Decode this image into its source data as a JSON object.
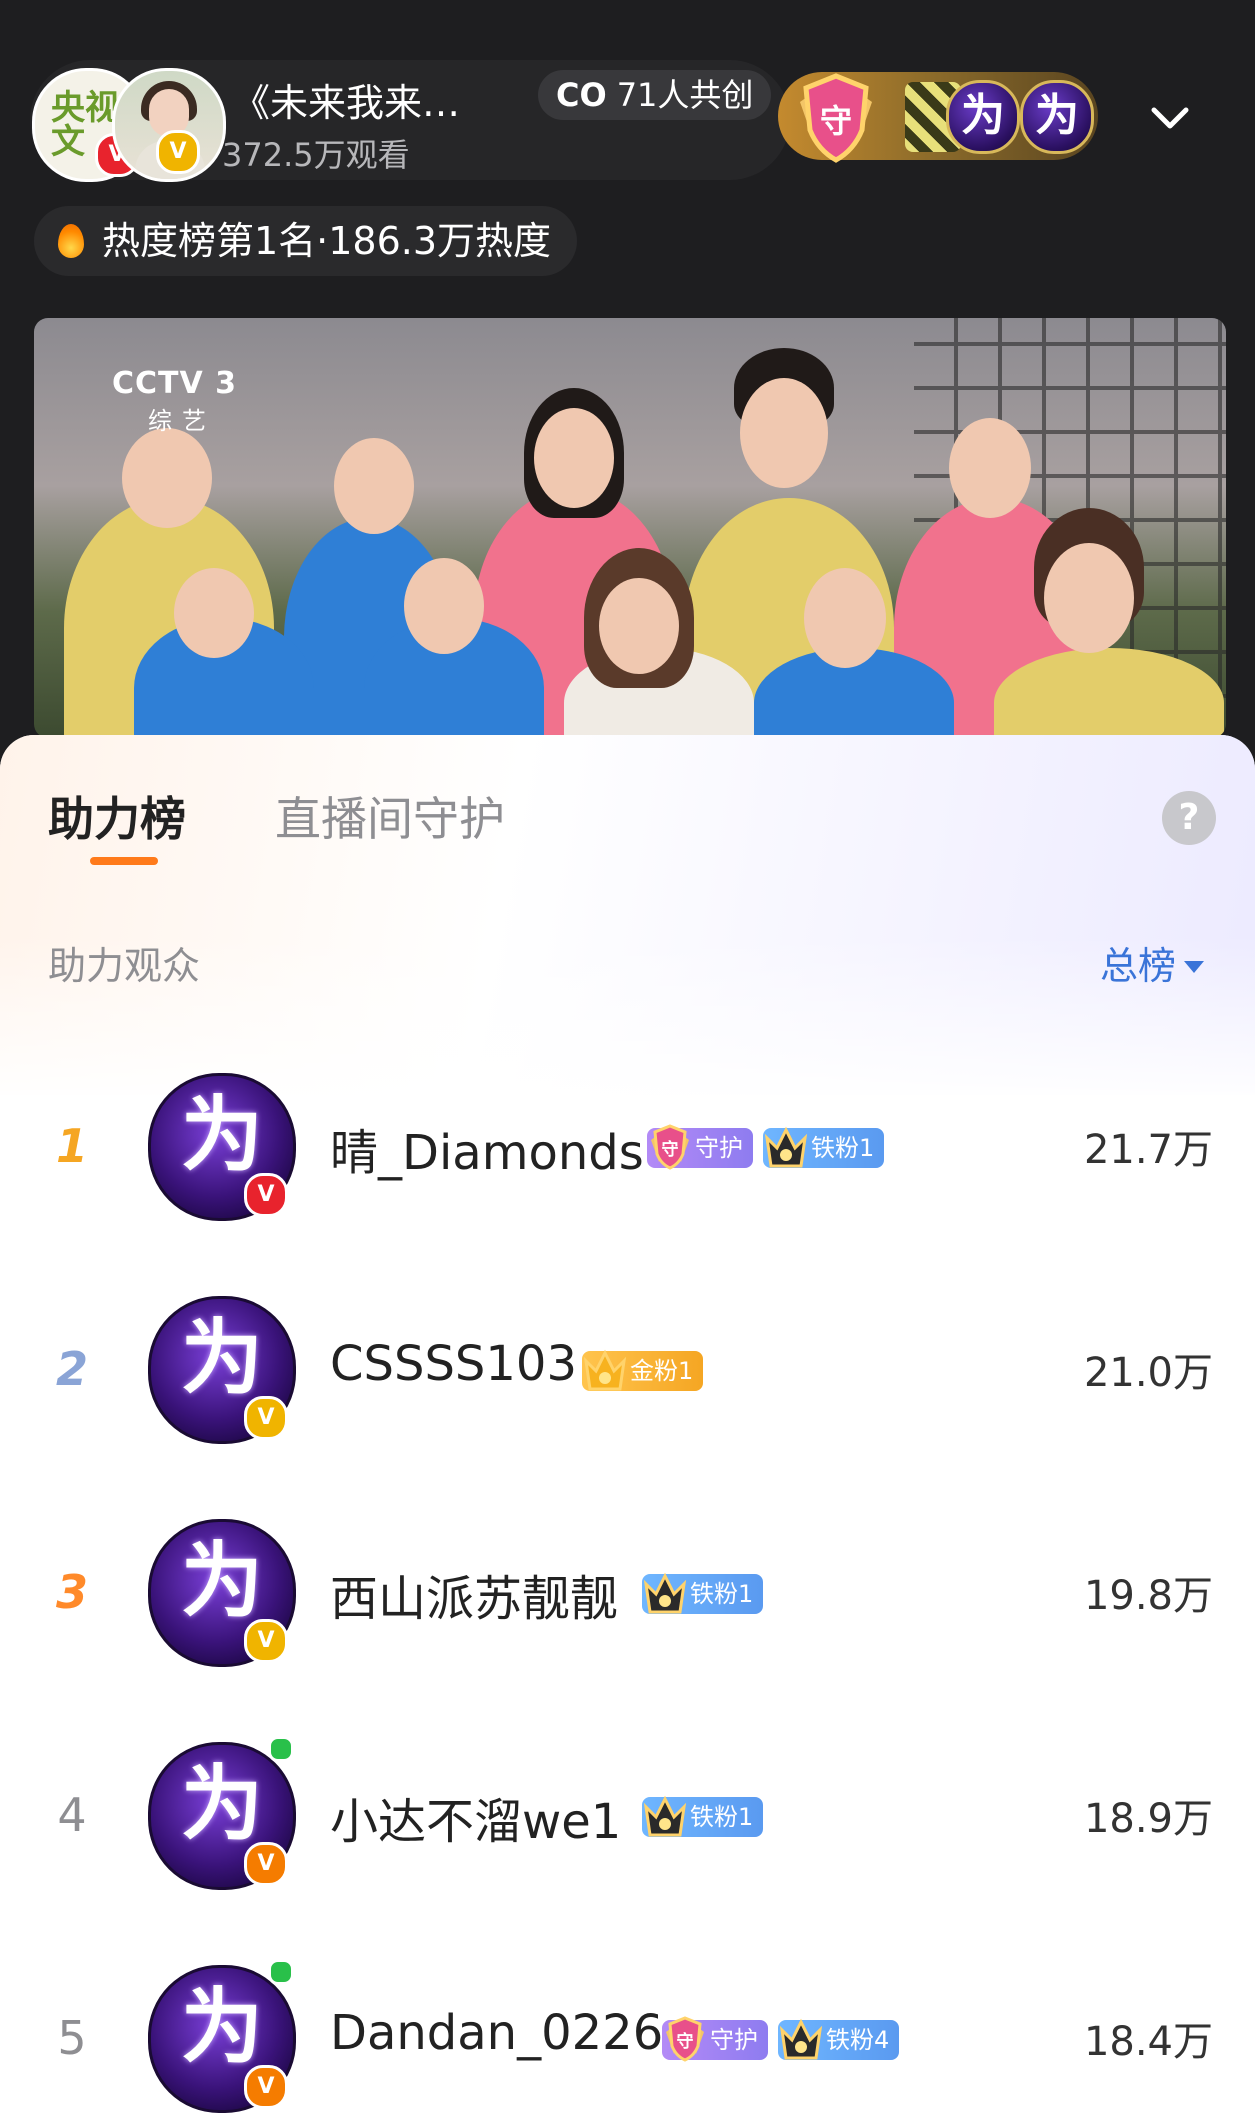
{
  "header": {
    "title": "《未来我来…",
    "views": "372.5万观看",
    "cocreate": "71人共创",
    "cocreate_icon": "co-icon",
    "guard_label": "守",
    "wei_char": "为",
    "heat_rank": "热度榜第1名·186.3万热度",
    "host_avatar_text": "央视文"
  },
  "video": {
    "channel": "CCTV 3",
    "channel_sub": "综艺"
  },
  "panel": {
    "tabs": [
      "助力榜",
      "直播间守护"
    ],
    "active_tab": 0,
    "subheading": "助力观众",
    "sort_label": "总榜",
    "help_label": "?"
  },
  "ranking": [
    {
      "rank": "1",
      "name": "晴_Diamonds",
      "badges": [
        {
          "type": "guard",
          "text": "守护"
        },
        {
          "type": "iron",
          "text": "铁粉1"
        }
      ],
      "score": "21.7万",
      "verify": "red",
      "online": false
    },
    {
      "rank": "2",
      "name": "CSSSS103",
      "badges": [
        {
          "type": "gold",
          "text": "金粉1"
        }
      ],
      "score": "21.0万",
      "verify": "yellow",
      "online": false
    },
    {
      "rank": "3",
      "name": "西山派苏靓靓",
      "badges": [
        {
          "type": "iron",
          "text": "铁粉1"
        }
      ],
      "score": "19.8万",
      "verify": "yellow",
      "online": false
    },
    {
      "rank": "4",
      "name": "小达不溜we1",
      "badges": [
        {
          "type": "iron",
          "text": "铁粉1"
        }
      ],
      "score": "18.9万",
      "verify": "orange",
      "online": true
    },
    {
      "rank": "5",
      "name": "Dandan_0226",
      "badges": [
        {
          "type": "guard",
          "text": "守护"
        },
        {
          "type": "iron",
          "text": "铁粉4"
        }
      ],
      "score": "18.4万",
      "verify": "orange",
      "online": true
    }
  ],
  "colors": {
    "accent_orange": "#ff7a1a",
    "link_blue": "#3a74d8",
    "rank1": "#f5a623",
    "rank2": "#8aa4d6",
    "rank3": "#ff8a2a",
    "rank_other": "#8e8e92",
    "verify_red": "#e8232d",
    "verify_yellow": "#f0b400",
    "verify_orange": "#f57c00"
  }
}
